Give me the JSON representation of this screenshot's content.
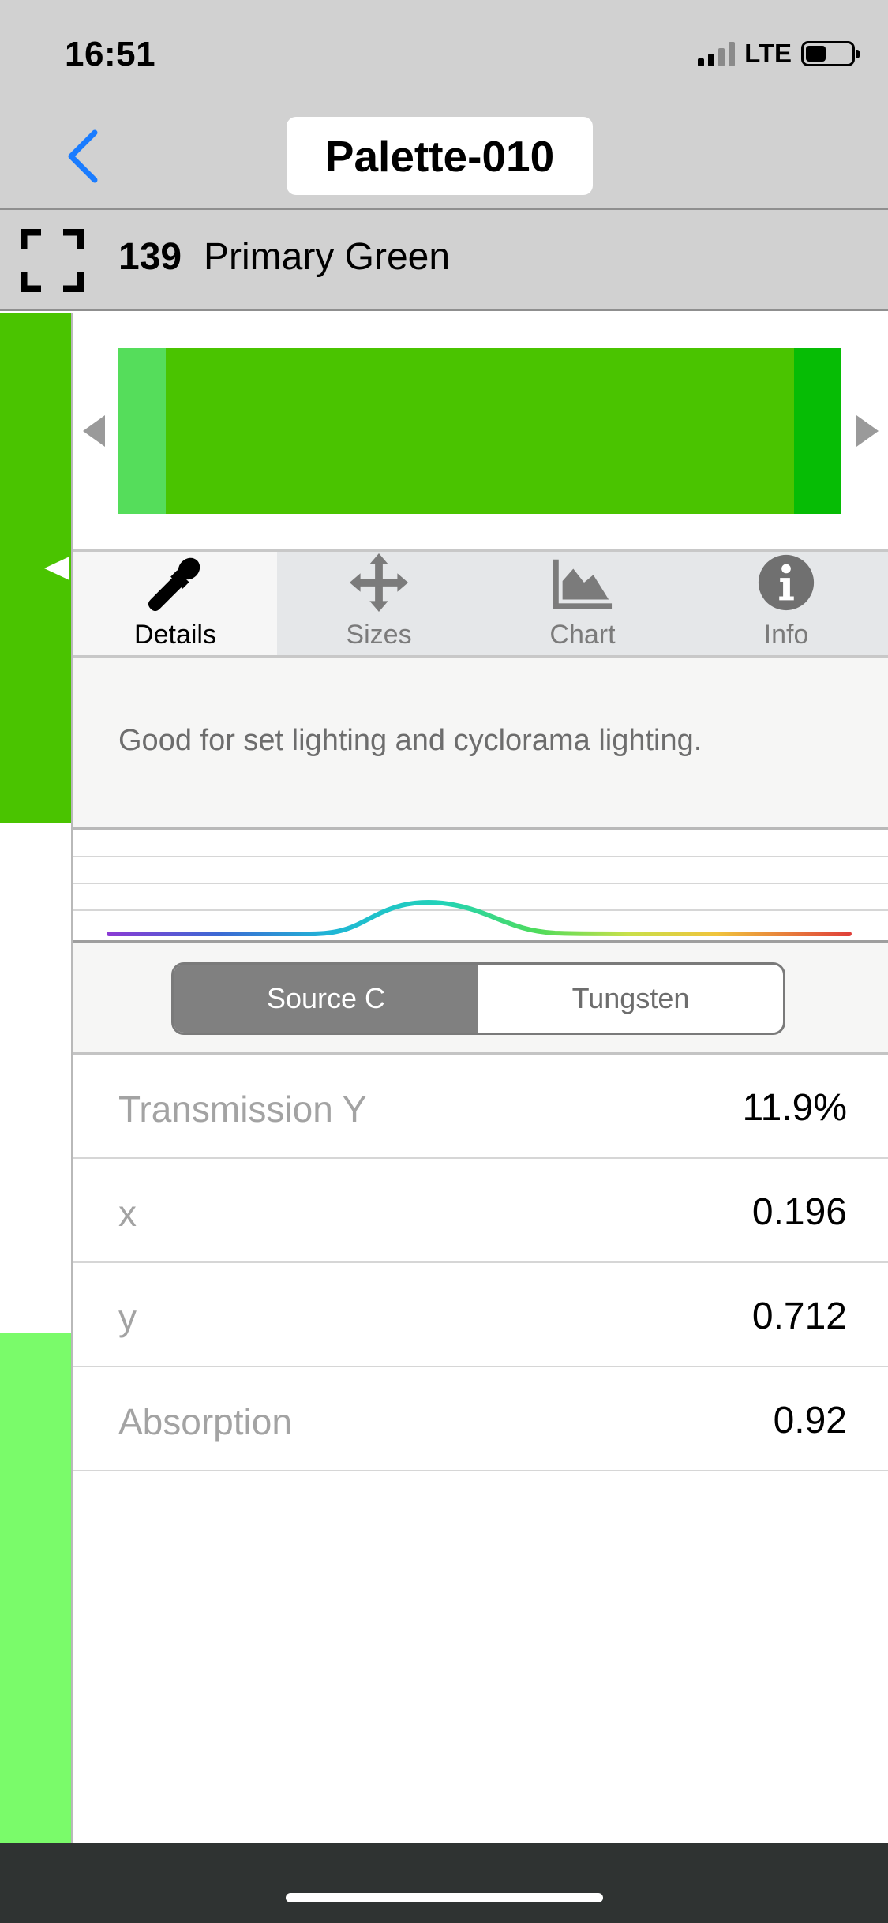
{
  "status_bar": {
    "time": "16:51",
    "network": "LTE"
  },
  "nav": {
    "title": "Palette-010"
  },
  "filter": {
    "number": "139",
    "name": "Primary Green"
  },
  "colors": {
    "strip": [
      "#4ac400",
      "#ffffff",
      "#7afb6a"
    ],
    "swatch": [
      "#55dd5b",
      "#4ac400",
      "#06bc05"
    ],
    "accent": "#1a7cff"
  },
  "tabs": [
    {
      "label": "Details",
      "icon": "eyedropper-icon",
      "active": true
    },
    {
      "label": "Sizes",
      "icon": "move-arrows-icon",
      "active": false
    },
    {
      "label": "Chart",
      "icon": "area-chart-icon",
      "active": false
    },
    {
      "label": "Info",
      "icon": "info-circle-icon",
      "active": false
    }
  ],
  "details": {
    "description": "Good for set lighting and cyclorama lighting."
  },
  "light_source": {
    "options": [
      "Source C",
      "Tungsten"
    ],
    "selected": "Source C"
  },
  "measurements": [
    {
      "label": "Transmission Y",
      "value": "11.9%"
    },
    {
      "label": "x",
      "value": "0.196"
    },
    {
      "label": "y",
      "value": "0.712"
    },
    {
      "label": "Absorption",
      "value": "0.92"
    }
  ]
}
